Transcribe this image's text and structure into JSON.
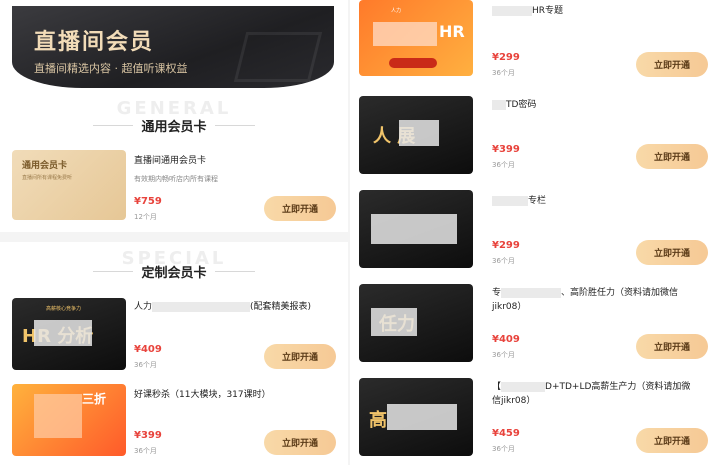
{
  "banner": {
    "title": "直播间会员",
    "subtitle": "直播间精选内容 · 超值听课权益"
  },
  "sections": {
    "general": {
      "bg": "GENERAL",
      "title": "通用会员卡"
    },
    "custom": {
      "bg": "SPECIAL",
      "title": "定制会员卡"
    }
  },
  "left_items": [
    {
      "thumb_label": "通用会员卡",
      "thumb_sub": "直播间所有课程免费听",
      "title": "直播间通用会员卡",
      "desc": "有效期内畅听店内所有课程",
      "price": "¥759",
      "duration": "12个月",
      "button": "立即开通"
    },
    {
      "thumb_label": "高薪核心竞争力",
      "thumb_big": "HR    分析",
      "title": "人力",
      "title_tail": "(配套精美报表)",
      "price": "¥409",
      "duration": "36个月",
      "button": "立即开通"
    },
    {
      "thumb_label": "三折",
      "title": "好课秒杀（11大模块，317课时）",
      "price": "¥399",
      "duration": "36个月",
      "button": "立即开通"
    }
  ],
  "right_items": [
    {
      "thumb_label": "HR",
      "thumb_top": "人力",
      "thumb_chip": "",
      "title": "HR专题",
      "price": "¥299",
      "duration": "36个月",
      "button": "立即开通"
    },
    {
      "thumb_big": "人    展",
      "title": "TD密码",
      "price": "¥399",
      "duration": "36个月",
      "button": "立即开通"
    },
    {
      "thumb_big": "",
      "title": "专栏",
      "price": "¥299",
      "duration": "36个月",
      "button": "立即开通"
    },
    {
      "thumb_big": "    任力",
      "title": "专",
      "title_tail": "、高阶胜任力（资料请加微信",
      "title_line2": "jikr08）",
      "price": "¥409",
      "duration": "36个月",
      "button": "立即开通"
    },
    {
      "thumb_big": "高",
      "title": "【",
      "title_tail": "D+TD+LD高薪生产力（资料请加微",
      "title_line2": "信jikr08）",
      "price": "¥459",
      "duration": "36个月",
      "button": "立即开通"
    }
  ],
  "colors": {
    "price": "#e8433c",
    "button": "#f6c995",
    "banner": "#1f1f22"
  }
}
